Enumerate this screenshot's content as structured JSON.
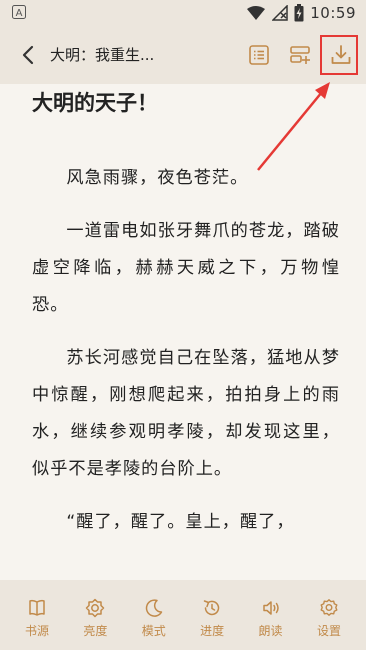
{
  "status_bar": {
    "time": "10:59"
  },
  "header": {
    "book_title": "大明：我重生..."
  },
  "content": {
    "chapter_title": "大明的天子！",
    "paragraphs": [
      "风急雨骤，夜色苍茫。",
      "一道雷电如张牙舞爪的苍龙，踏破虚空降临，赫赫天威之下，万物惶恐。",
      "苏长河感觉自己在坠落，猛地从梦中惊醒，刚想爬起来，拍拍身上的雨水，继续参观明孝陵，却发现这里，似乎不是孝陵的台阶上。",
      "“醒了，醒了。皇上，醒了，"
    ]
  },
  "bottom_bar": {
    "items": [
      {
        "label": "书源",
        "icon": "book-source-icon"
      },
      {
        "label": "亮度",
        "icon": "brightness-icon"
      },
      {
        "label": "模式",
        "icon": "moon-icon"
      },
      {
        "label": "进度",
        "icon": "progress-icon"
      },
      {
        "label": "朗读",
        "icon": "speaker-icon"
      },
      {
        "label": "设置",
        "icon": "gear-icon"
      }
    ]
  },
  "colors": {
    "accent": "#c18a4a",
    "bar_bg": "#ece6dd",
    "page_bg": "#f7f4ef",
    "highlight": "#e53935"
  }
}
